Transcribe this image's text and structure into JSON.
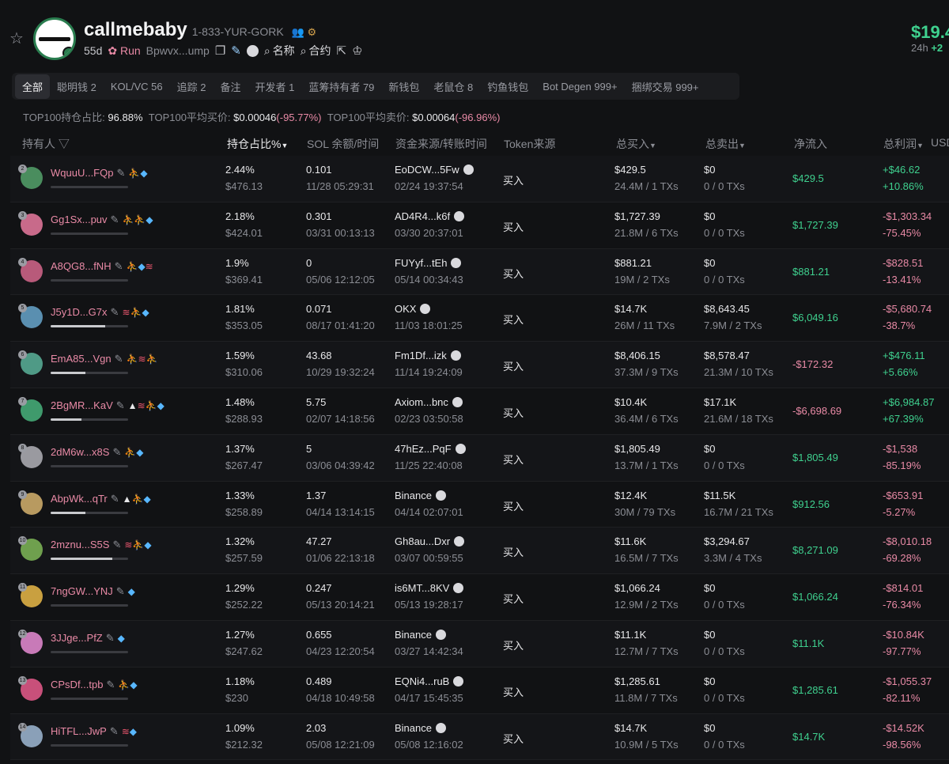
{
  "header": {
    "token_name": "callmebaby",
    "token_symbol": "1-833-YUR-GORK",
    "age": "55d",
    "run_label": "Run",
    "address": "Bpwvx...ump",
    "name_label": "名称",
    "contract_label": "合约",
    "price": "$19.4",
    "price_period": "24h",
    "price_change": "+2"
  },
  "tabs": [
    {
      "label": "全部",
      "active": true
    },
    {
      "label": "聪明钱 2"
    },
    {
      "label": "KOL/VC 56"
    },
    {
      "label": "追踪 2"
    },
    {
      "label": "备注"
    },
    {
      "label": "开发者 1"
    },
    {
      "label": "蓝筹持有者 79"
    },
    {
      "label": "新钱包"
    },
    {
      "label": "老鼠仓 8"
    },
    {
      "label": "钓鱼钱包"
    },
    {
      "label": "Bot Degen 999+"
    },
    {
      "label": "捆绑交易 999+"
    }
  ],
  "stats": {
    "top100_share_label": "TOP100持仓占比:",
    "top100_share": "96.88%",
    "avg_buy_label": "TOP100平均买价:",
    "avg_buy": "$0.00046",
    "avg_buy_change": "(-95.77%)",
    "avg_sell_label": "TOP100平均卖价:",
    "avg_sell": "$0.00064",
    "avg_sell_change": "(-96.96%)"
  },
  "columns": {
    "holder": "持有人",
    "share": "持仓占比%",
    "sol": "SOL 余额/时间",
    "source": "资金来源/转账时间",
    "token_source": "Token来源",
    "total_buy": "总买入",
    "total_sell": "总卖出",
    "net_inflow": "净流入",
    "total_profit": "总利润",
    "usd": "USD"
  },
  "rows": [
    {
      "rank": "2",
      "addr": "WquuU...FQp",
      "share": "2.44%",
      "share_usd": "$476.13",
      "sol": "0.101",
      "sol_time": "11/28 05:29:31",
      "src": "EoDCW...5Fw",
      "src_time": "02/24 19:37:54",
      "token_src": "买入",
      "buy": "$429.5",
      "buy_sub": "24.4M / 1 TXs",
      "sell": "$0",
      "sell_sub": "0 / 0 TXs",
      "net": "$429.5",
      "net_sign": "pos",
      "profit": "+$46.62",
      "profit_pct": "+10.86%",
      "profit_sign": "pos",
      "tags": [
        "g",
        "b"
      ],
      "bar": 0.0,
      "avatar": "#4a8d5e"
    },
    {
      "rank": "3",
      "addr": "Gg1Sx...puv",
      "share": "2.18%",
      "share_usd": "$424.01",
      "sol": "0.301",
      "sol_time": "03/31 00:13:13",
      "src": "AD4R4...k6f",
      "src_time": "03/30 20:37:01",
      "token_src": "买入",
      "buy": "$1,727.39",
      "buy_sub": "21.8M / 6 TXs",
      "sell": "$0",
      "sell_sub": "0 / 0 TXs",
      "net": "$1,727.39",
      "net_sign": "pos",
      "profit": "-$1,303.34",
      "profit_pct": "-75.45%",
      "profit_sign": "neg",
      "tags": [
        "g",
        "g",
        "b"
      ],
      "bar": 0.0,
      "avatar": "#c86a8a"
    },
    {
      "rank": "4",
      "addr": "A8QG8...fNH",
      "share": "1.9%",
      "share_usd": "$369.41",
      "sol": "0",
      "sol_time": "05/06 12:12:05",
      "src": "FUYyf...tEh",
      "src_time": "05/14 00:34:43",
      "token_src": "买入",
      "buy": "$881.21",
      "buy_sub": "19M / 2 TXs",
      "sell": "$0",
      "sell_sub": "0 / 0 TXs",
      "net": "$881.21",
      "net_sign": "pos",
      "profit": "-$828.51",
      "profit_pct": "-13.41%",
      "profit_sign": "neg",
      "tags": [
        "g",
        "b",
        "r"
      ],
      "bar": 0.0,
      "avatar": "#b85a7a"
    },
    {
      "rank": "5",
      "addr": "J5y1D...G7x",
      "share": "1.81%",
      "share_usd": "$353.05",
      "sol": "0.071",
      "sol_time": "08/17 01:41:20",
      "src": "OKX",
      "src_time": "11/03 18:01:25",
      "token_src": "买入",
      "buy": "$14.7K",
      "buy_sub": "26M / 11 TXs",
      "sell": "$8,643.45",
      "sell_sub": "7.9M / 2 TXs",
      "net": "$6,049.16",
      "net_sign": "pos",
      "profit": "-$5,680.74",
      "profit_pct": "-38.7%",
      "profit_sign": "neg",
      "tags": [
        "r",
        "g",
        "b"
      ],
      "bar": 0.7,
      "avatar": "#5a8fb0"
    },
    {
      "rank": "6",
      "addr": "EmA85...Vgn",
      "share": "1.59%",
      "share_usd": "$310.06",
      "sol": "43.68",
      "sol_time": "10/29 19:32:24",
      "src": "Fm1Df...izk",
      "src_time": "11/14 19:24:09",
      "token_src": "买入",
      "buy": "$8,406.15",
      "buy_sub": "37.3M / 9 TXs",
      "sell": "$8,578.47",
      "sell_sub": "21.3M / 10 TXs",
      "net": "-$172.32",
      "net_sign": "neg",
      "profit": "+$476.11",
      "profit_pct": "+5.66%",
      "profit_sign": "pos",
      "tags": [
        "g",
        "r",
        "g"
      ],
      "bar": 0.45,
      "avatar": "#4f9a86"
    },
    {
      "rank": "7",
      "addr": "2BgMR...KaV",
      "share": "1.48%",
      "share_usd": "$288.93",
      "sol": "5.75",
      "sol_time": "02/07 14:18:56",
      "src": "Axiom...bnc",
      "src_time": "02/23 03:50:58",
      "token_src": "买入",
      "buy": "$10.4K",
      "buy_sub": "36.4M / 6 TXs",
      "sell": "$17.1K",
      "sell_sub": "21.6M / 18 TXs",
      "net": "-$6,698.69",
      "net_sign": "neg",
      "profit": "+$6,984.87",
      "profit_pct": "+67.39%",
      "profit_sign": "pos",
      "tags": [
        "w",
        "r",
        "g",
        "b"
      ],
      "bar": 0.4,
      "avatar": "#3f9a6c"
    },
    {
      "rank": "8",
      "addr": "2dM6w...x8S",
      "share": "1.37%",
      "share_usd": "$267.47",
      "sol": "5",
      "sol_time": "03/06 04:39:42",
      "src": "47hEz...PqF",
      "src_time": "11/25 22:40:08",
      "token_src": "买入",
      "buy": "$1,805.49",
      "buy_sub": "13.7M / 1 TXs",
      "sell": "$0",
      "sell_sub": "0 / 0 TXs",
      "net": "$1,805.49",
      "net_sign": "pos",
      "profit": "-$1,538",
      "profit_pct": "-85.19%",
      "profit_sign": "neg",
      "tags": [
        "g",
        "b"
      ],
      "bar": 0.0,
      "avatar": "#9a9aa0"
    },
    {
      "rank": "9",
      "addr": "AbpWk...qTr",
      "share": "1.33%",
      "share_usd": "$258.89",
      "sol": "1.37",
      "sol_time": "04/14 13:14:15",
      "src": "Binance",
      "src_time": "04/14 02:07:01",
      "token_src": "买入",
      "buy": "$12.4K",
      "buy_sub": "30M / 79 TXs",
      "sell": "$11.5K",
      "sell_sub": "16.7M / 21 TXs",
      "net": "$912.56",
      "net_sign": "pos",
      "profit": "-$653.91",
      "profit_pct": "-5.27%",
      "profit_sign": "neg",
      "tags": [
        "w",
        "g",
        "b"
      ],
      "bar": 0.45,
      "avatar": "#b89a60"
    },
    {
      "rank": "10",
      "addr": "2mznu...S5S",
      "share": "1.32%",
      "share_usd": "$257.59",
      "sol": "47.27",
      "sol_time": "01/06 22:13:18",
      "src": "Gh8au...Dxr",
      "src_time": "03/07 00:59:55",
      "token_src": "买入",
      "buy": "$11.6K",
      "buy_sub": "16.5M / 7 TXs",
      "sell": "$3,294.67",
      "sell_sub": "3.3M / 4 TXs",
      "net": "$8,271.09",
      "net_sign": "pos",
      "profit": "-$8,010.18",
      "profit_pct": "-69.28%",
      "profit_sign": "neg",
      "tags": [
        "r",
        "g",
        "b"
      ],
      "bar": 0.8,
      "avatar": "#6fa04e"
    },
    {
      "rank": "11",
      "addr": "7ngGW...YNJ",
      "share": "1.29%",
      "share_usd": "$252.22",
      "sol": "0.247",
      "sol_time": "05/13 20:14:21",
      "src": "is6MT...8KV",
      "src_time": "05/13 19:28:17",
      "token_src": "买入",
      "buy": "$1,066.24",
      "buy_sub": "12.9M / 2 TXs",
      "sell": "$0",
      "sell_sub": "0 / 0 TXs",
      "net": "$1,066.24",
      "net_sign": "pos",
      "profit": "-$814.01",
      "profit_pct": "-76.34%",
      "profit_sign": "neg",
      "tags": [
        "b"
      ],
      "bar": 0.0,
      "avatar": "#c9a040"
    },
    {
      "rank": "12",
      "addr": "3JJge...PfZ",
      "share": "1.27%",
      "share_usd": "$247.62",
      "sol": "0.655",
      "sol_time": "04/23 12:20:54",
      "src": "Binance",
      "src_time": "03/27 14:42:34",
      "token_src": "买入",
      "buy": "$11.1K",
      "buy_sub": "12.7M / 7 TXs",
      "sell": "$0",
      "sell_sub": "0 / 0 TXs",
      "net": "$11.1K",
      "net_sign": "pos",
      "profit": "-$10.84K",
      "profit_pct": "-97.77%",
      "profit_sign": "neg",
      "tags": [
        "b"
      ],
      "bar": 0.0,
      "avatar": "#c87ab8"
    },
    {
      "rank": "13",
      "addr": "CPsDf...tpb",
      "share": "1.18%",
      "share_usd": "$230",
      "sol": "0.489",
      "sol_time": "04/18 10:49:58",
      "src": "EQNi4...ruB",
      "src_time": "04/17 15:45:35",
      "token_src": "买入",
      "buy": "$1,285.61",
      "buy_sub": "11.8M / 7 TXs",
      "sell": "$0",
      "sell_sub": "0 / 0 TXs",
      "net": "$1,285.61",
      "net_sign": "pos",
      "profit": "-$1,055.37",
      "profit_pct": "-82.11%",
      "profit_sign": "neg",
      "tags": [
        "bu",
        "b"
      ],
      "bar": 0.0,
      "avatar": "#c8507a"
    },
    {
      "rank": "14",
      "addr": "HiTFL...JwP",
      "share": "1.09%",
      "share_usd": "$212.32",
      "sol": "2.03",
      "sol_time": "05/08 12:21:09",
      "src": "Binance",
      "src_time": "05/08 12:16:02",
      "token_src": "买入",
      "buy": "$14.7K",
      "buy_sub": "10.9M / 5 TXs",
      "sell": "$0",
      "sell_sub": "0 / 0 TXs",
      "net": "$14.7K",
      "net_sign": "pos",
      "profit": "-$14.52K",
      "profit_pct": "-98.56%",
      "profit_sign": "neg",
      "tags": [
        "r",
        "b"
      ],
      "bar": 0.0,
      "avatar": "#8aa0b8"
    }
  ]
}
